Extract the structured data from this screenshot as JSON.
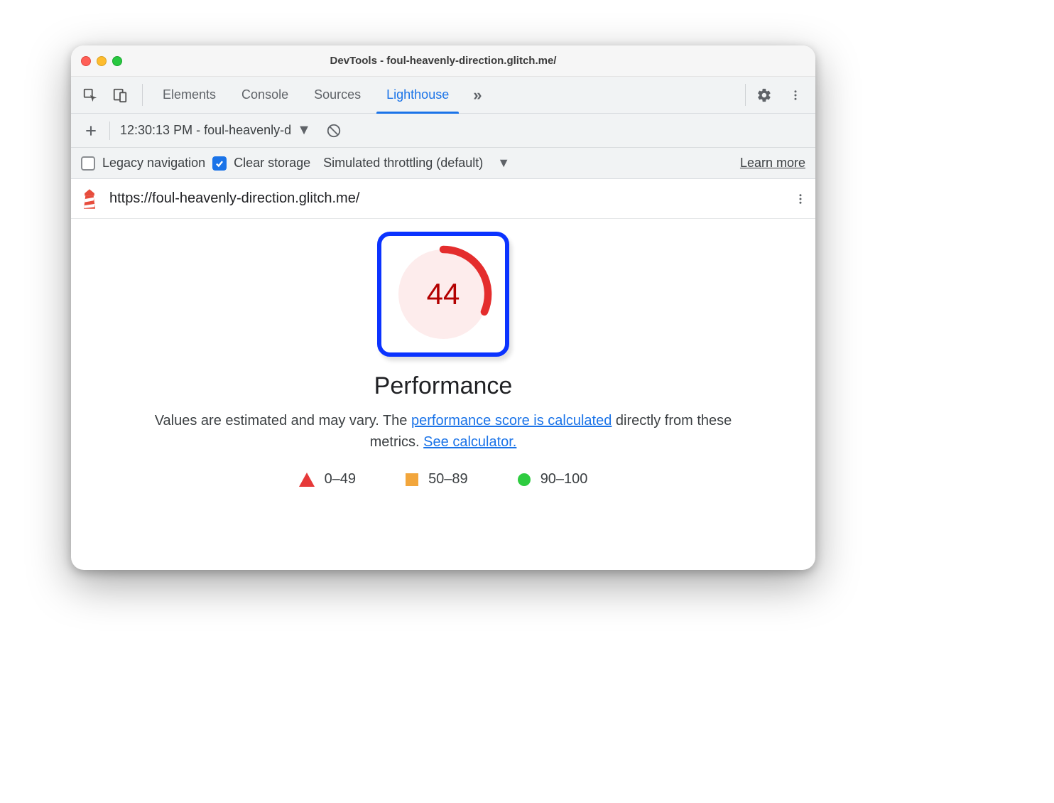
{
  "window": {
    "title": "DevTools - foul-heavenly-direction.glitch.me/"
  },
  "tabs": {
    "elements": "Elements",
    "console": "Console",
    "sources": "Sources",
    "lighthouse": "Lighthouse"
  },
  "subbar": {
    "report_label": "12:30:13 PM - foul-heavenly-d"
  },
  "options": {
    "legacy": "Legacy navigation",
    "clear": "Clear storage",
    "throttling": "Simulated throttling (default)",
    "learn": "Learn more"
  },
  "urlbar": {
    "url": "https://foul-heavenly-direction.glitch.me/"
  },
  "report": {
    "score": "44",
    "category": "Performance",
    "desc_prefix": "Values are estimated and may vary. The ",
    "link1": "performance score is calculated",
    "desc_mid": " directly from these metrics. ",
    "link2": "See calculator."
  },
  "legend": {
    "bad": "0–49",
    "mid": "50–89",
    "good": "90–100"
  },
  "chart_data": {
    "type": "pie",
    "title": "Performance",
    "series": [
      {
        "name": "Performance",
        "values": [
          44
        ]
      }
    ],
    "ylim": [
      0,
      100
    ],
    "legend": [
      {
        "label": "0–49",
        "color": "#e63939",
        "shape": "triangle"
      },
      {
        "label": "50–89",
        "color": "#f2a63c",
        "shape": "square"
      },
      {
        "label": "90–100",
        "color": "#2ecc40",
        "shape": "circle"
      }
    ]
  }
}
